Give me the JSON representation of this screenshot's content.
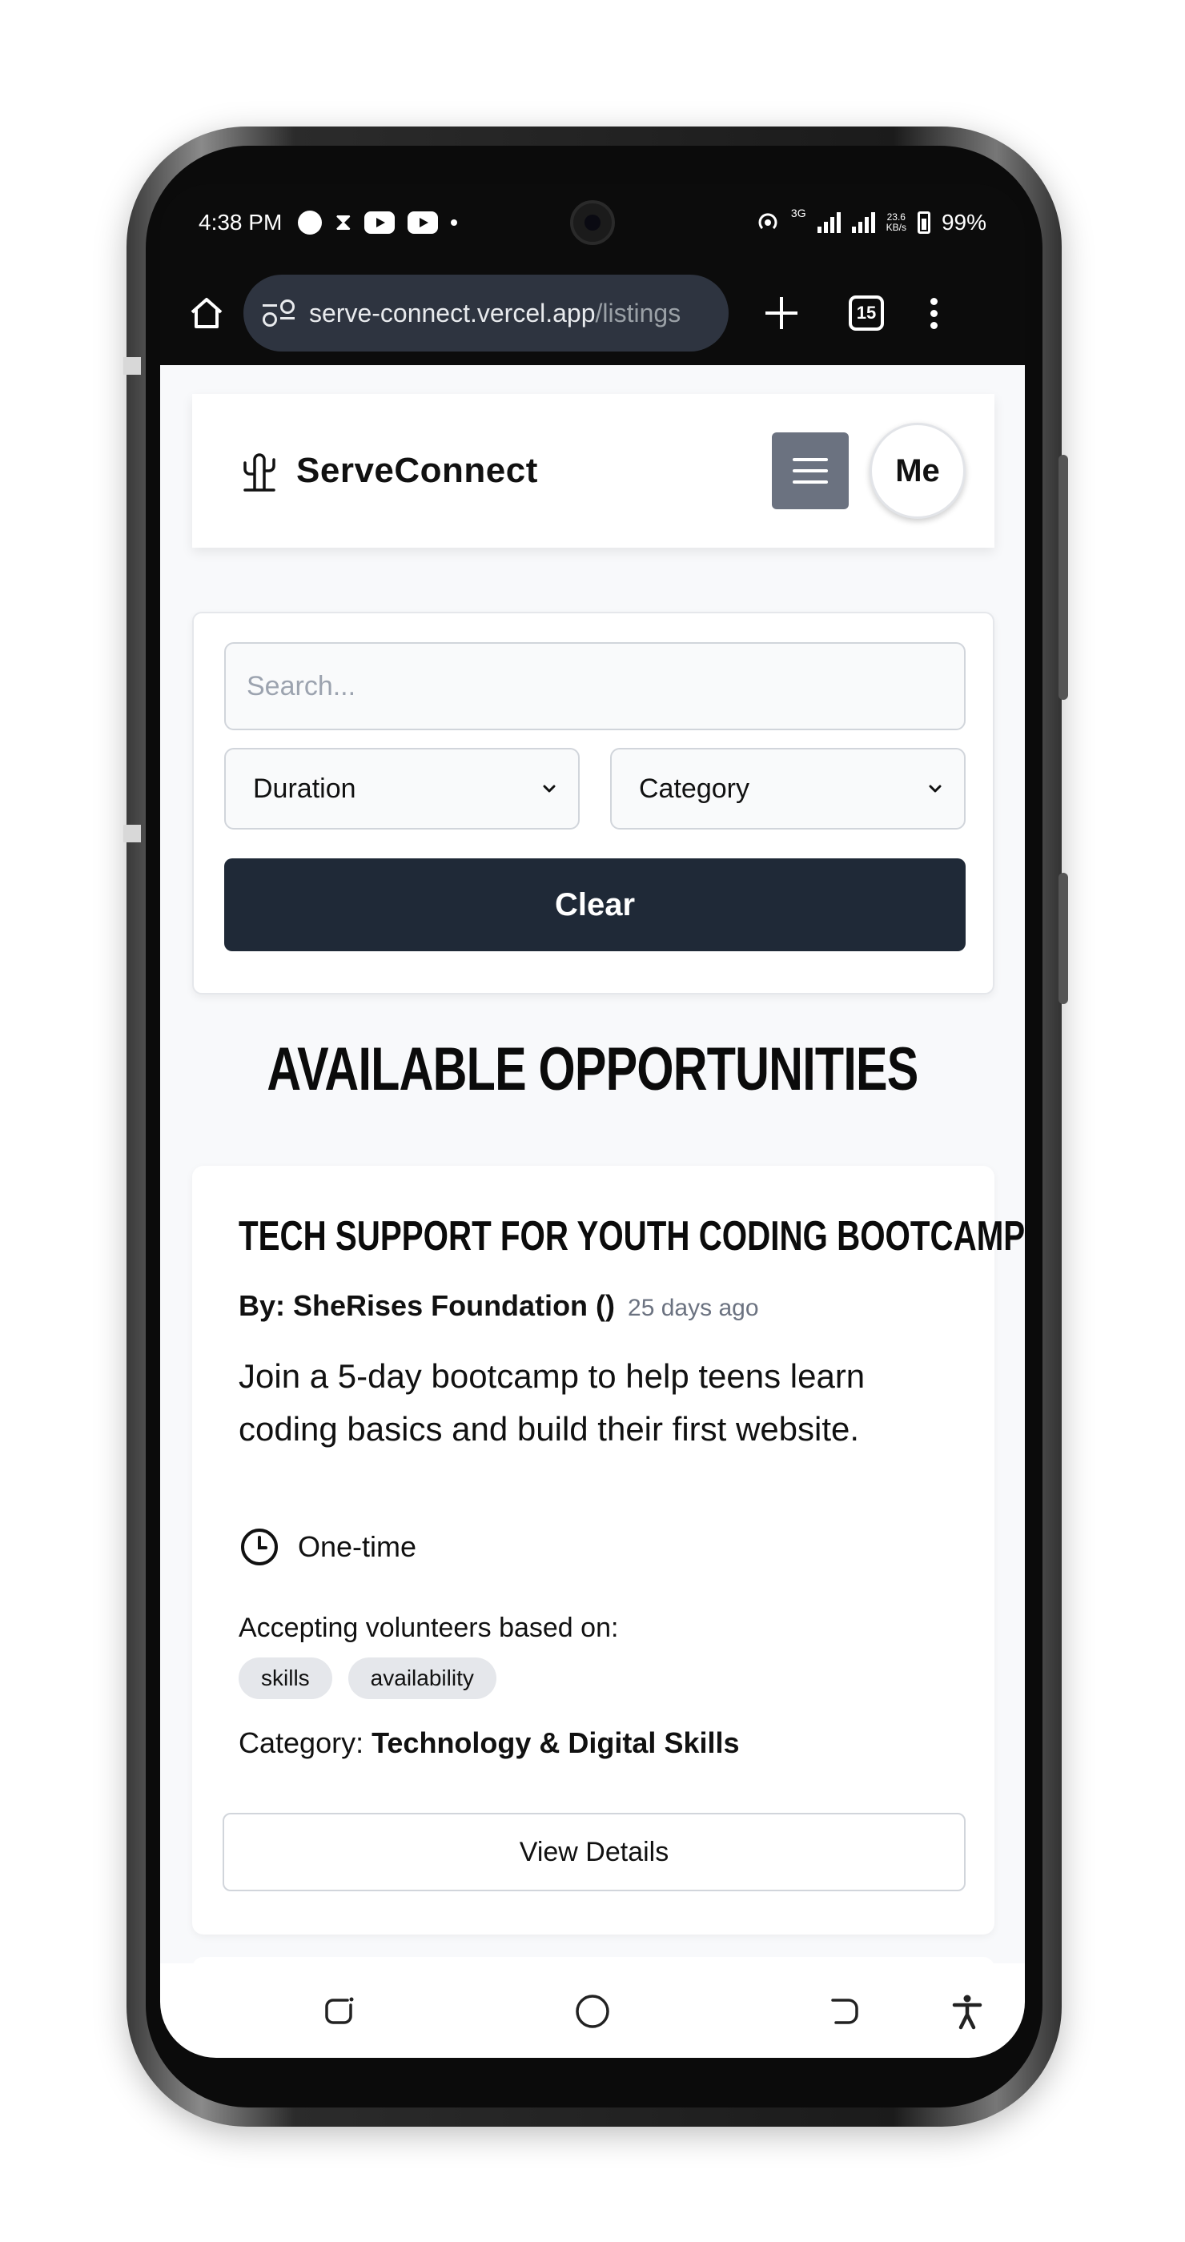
{
  "status_bar": {
    "time": "4:38 PM",
    "network_type": "3G",
    "net_speed_value": "23.6",
    "net_speed_unit": "KB/s",
    "battery": "99%"
  },
  "browser": {
    "url_host": "serve-connect.vercel.app",
    "url_path": "/listings",
    "tab_count": "15"
  },
  "header": {
    "brand_name": "ServeConnect",
    "avatar_label": "Me"
  },
  "filters": {
    "search_placeholder": "Search...",
    "duration_value": "Duration",
    "category_value": "Category",
    "clear_label": "Clear"
  },
  "section_title": "AVAILABLE OPPORTUNITIES",
  "listings": [
    {
      "title": "TECH SUPPORT FOR YOUTH CODING BOOTCAMP",
      "by_label": "By: SheRises Foundation ()",
      "posted": "25 days ago",
      "description": "Join a 5-day bootcamp to help teens learn coding basics and build their first website.",
      "duration": "One-time",
      "accepting_label": "Accepting volunteers based on:",
      "tags": [
        "skills",
        "availability"
      ],
      "category_label": "Category:",
      "category_value": "Technology & Digital Skills",
      "details_label": "View Details"
    }
  ],
  "colors": {
    "header_button": "#6b7280",
    "clear_button": "#1f2937",
    "page_bg": "#f8f9fb",
    "tag_bg": "#e5e7eb"
  }
}
